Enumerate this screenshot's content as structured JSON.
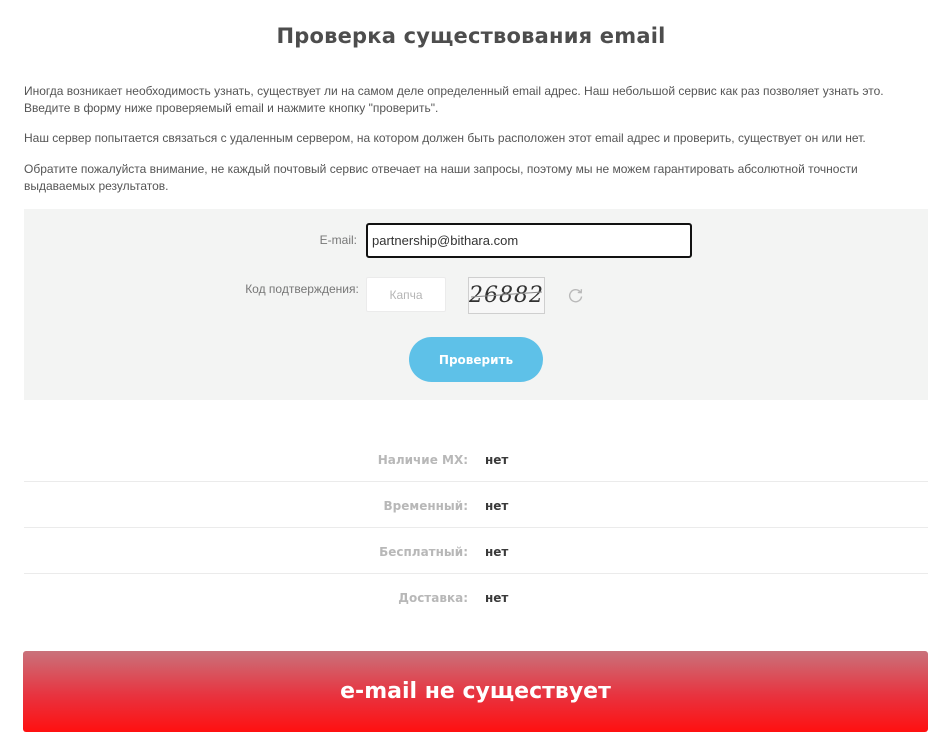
{
  "page": {
    "title": "Проверка существования email",
    "intro": [
      "Иногда возникает необходимость узнать, существует ли на самом деле определенный email адрес. Наш небольшой сервис как раз позволяет узнать это. Введите в форму ниже проверяемый email и нажмите кнопку \"проверить\".",
      "Наш сервер попытается связаться с удаленным сервером, на котором должен быть расположен этот email адрес и проверить, существует он или нет.",
      "Обратите пожалуйста внимание, не каждый почтовый сервис отвечает на наши запросы, поэтому мы не можем гарантировать абсолютной точности выдаваемых результатов."
    ]
  },
  "form": {
    "email_label": "E-mail:",
    "email_value": "partnership@bithara.com",
    "code_label": "Код подтверждения:",
    "captcha_placeholder": "Капча",
    "captcha_text": "26882",
    "refresh_icon": "refresh-icon",
    "submit_label": "Проверить"
  },
  "results": [
    {
      "label": "Наличие MX:",
      "value": "нет"
    },
    {
      "label": "Временный:",
      "value": "нет"
    },
    {
      "label": "Бесплатный:",
      "value": "нет"
    },
    {
      "label": "Доставка:",
      "value": "нет"
    }
  ],
  "verdict": "e-mail не существует",
  "colors": {
    "button": "#5ec1e8",
    "banner_top": "#c9727b",
    "banner_bottom": "#ff1010",
    "panel": "#f3f4f3"
  }
}
